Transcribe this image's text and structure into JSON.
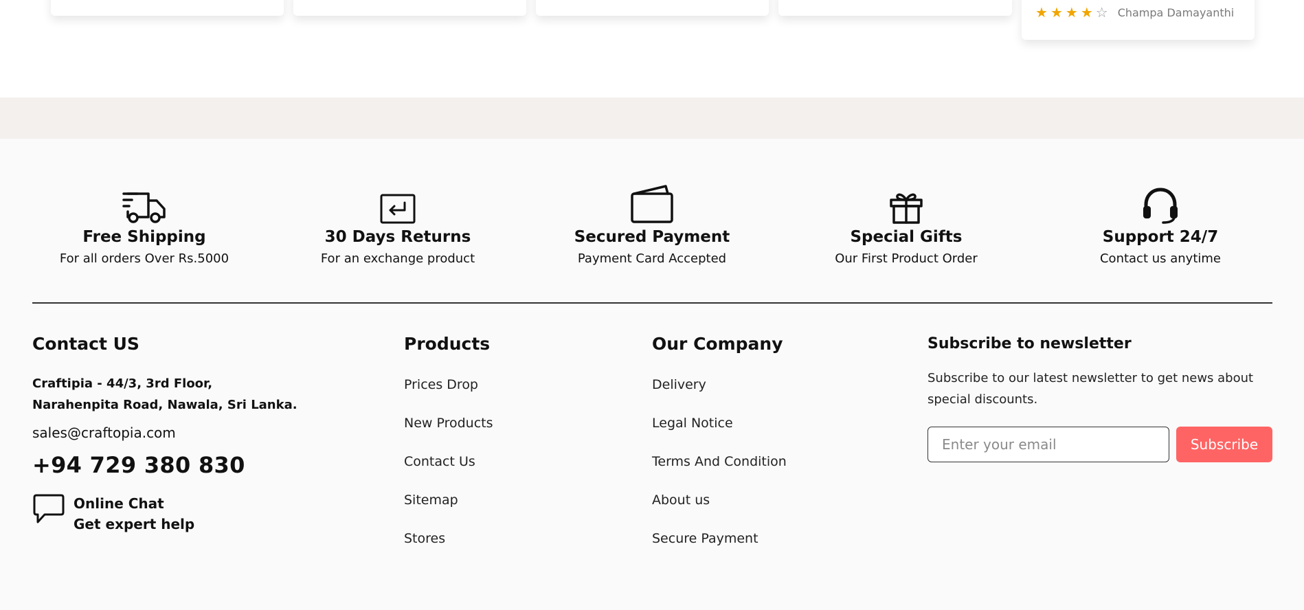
{
  "review": {
    "stars_filled": 4,
    "stars_total": 5,
    "reviewer_name": "Champa Damayanthi"
  },
  "features": [
    {
      "icon": "truck-icon",
      "title": "Free Shipping",
      "subtitle": "For all orders Over Rs.5000"
    },
    {
      "icon": "return-icon",
      "title": "30 Days Returns",
      "subtitle": "For an exchange product"
    },
    {
      "icon": "wallet-icon",
      "title": "Secured Payment",
      "subtitle": "Payment Card Accepted"
    },
    {
      "icon": "gift-icon",
      "title": "Special Gifts",
      "subtitle": "Our First Product Order"
    },
    {
      "icon": "headset-icon",
      "title": "Support 24/7",
      "subtitle": "Contact us anytime"
    }
  ],
  "contact": {
    "heading": "Contact US",
    "address_line1": "Craftipia - 44/3, 3rd Floor,",
    "address_line2": "Narahenpita Road, Nawala, Sri Lanka.",
    "email": "sales@craftopia.com",
    "phone": "+94 729 380 830",
    "chat_line1": "Online Chat",
    "chat_line2": "Get expert help"
  },
  "products": {
    "heading": "Products",
    "items": [
      "Prices Drop",
      "New Products",
      "Contact Us",
      "Sitemap",
      "Stores"
    ]
  },
  "company": {
    "heading": "Our Company",
    "items": [
      "Delivery",
      "Legal Notice",
      "Terms And Condition",
      "About us",
      "Secure Payment"
    ]
  },
  "newsletter": {
    "heading": "Subscribe to newsletter",
    "description": "Subscribe to our latest newsletter to get news about special discounts.",
    "placeholder": "Enter your email",
    "button_label": "Subscribe"
  },
  "colors": {
    "star": "#f0a500",
    "subscribe_button": "#ff6464",
    "band": "#f4f0ee",
    "footer_bg": "#fafafa"
  }
}
